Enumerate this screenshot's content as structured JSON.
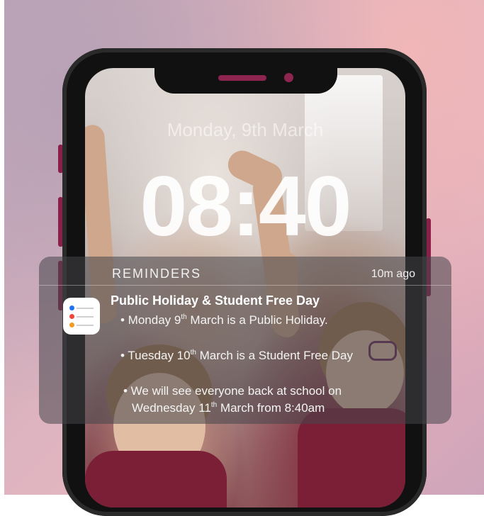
{
  "lock_screen": {
    "date": "Monday, 9th March",
    "time": "08:40"
  },
  "notification": {
    "app_name": "REMINDERS",
    "time_ago": "10m ago",
    "title": "Public Holiday & Student Free Day",
    "bullets": [
      {
        "pre": "• Monday 9",
        "sup": "th",
        "post": " March is a Public Holiday."
      },
      {
        "pre": "• Tuesday 10",
        "sup": "th",
        "post": " March is a Student Free Day"
      },
      {
        "line1": "• We will see everyone back at school on",
        "pre": "Wednesday 11",
        "sup": "th",
        "post": " March from 8:40am"
      }
    ],
    "icon": "reminders-app-icon"
  },
  "colors": {
    "phone_accent": "#8e2450",
    "uniform": "#7a1f36"
  }
}
